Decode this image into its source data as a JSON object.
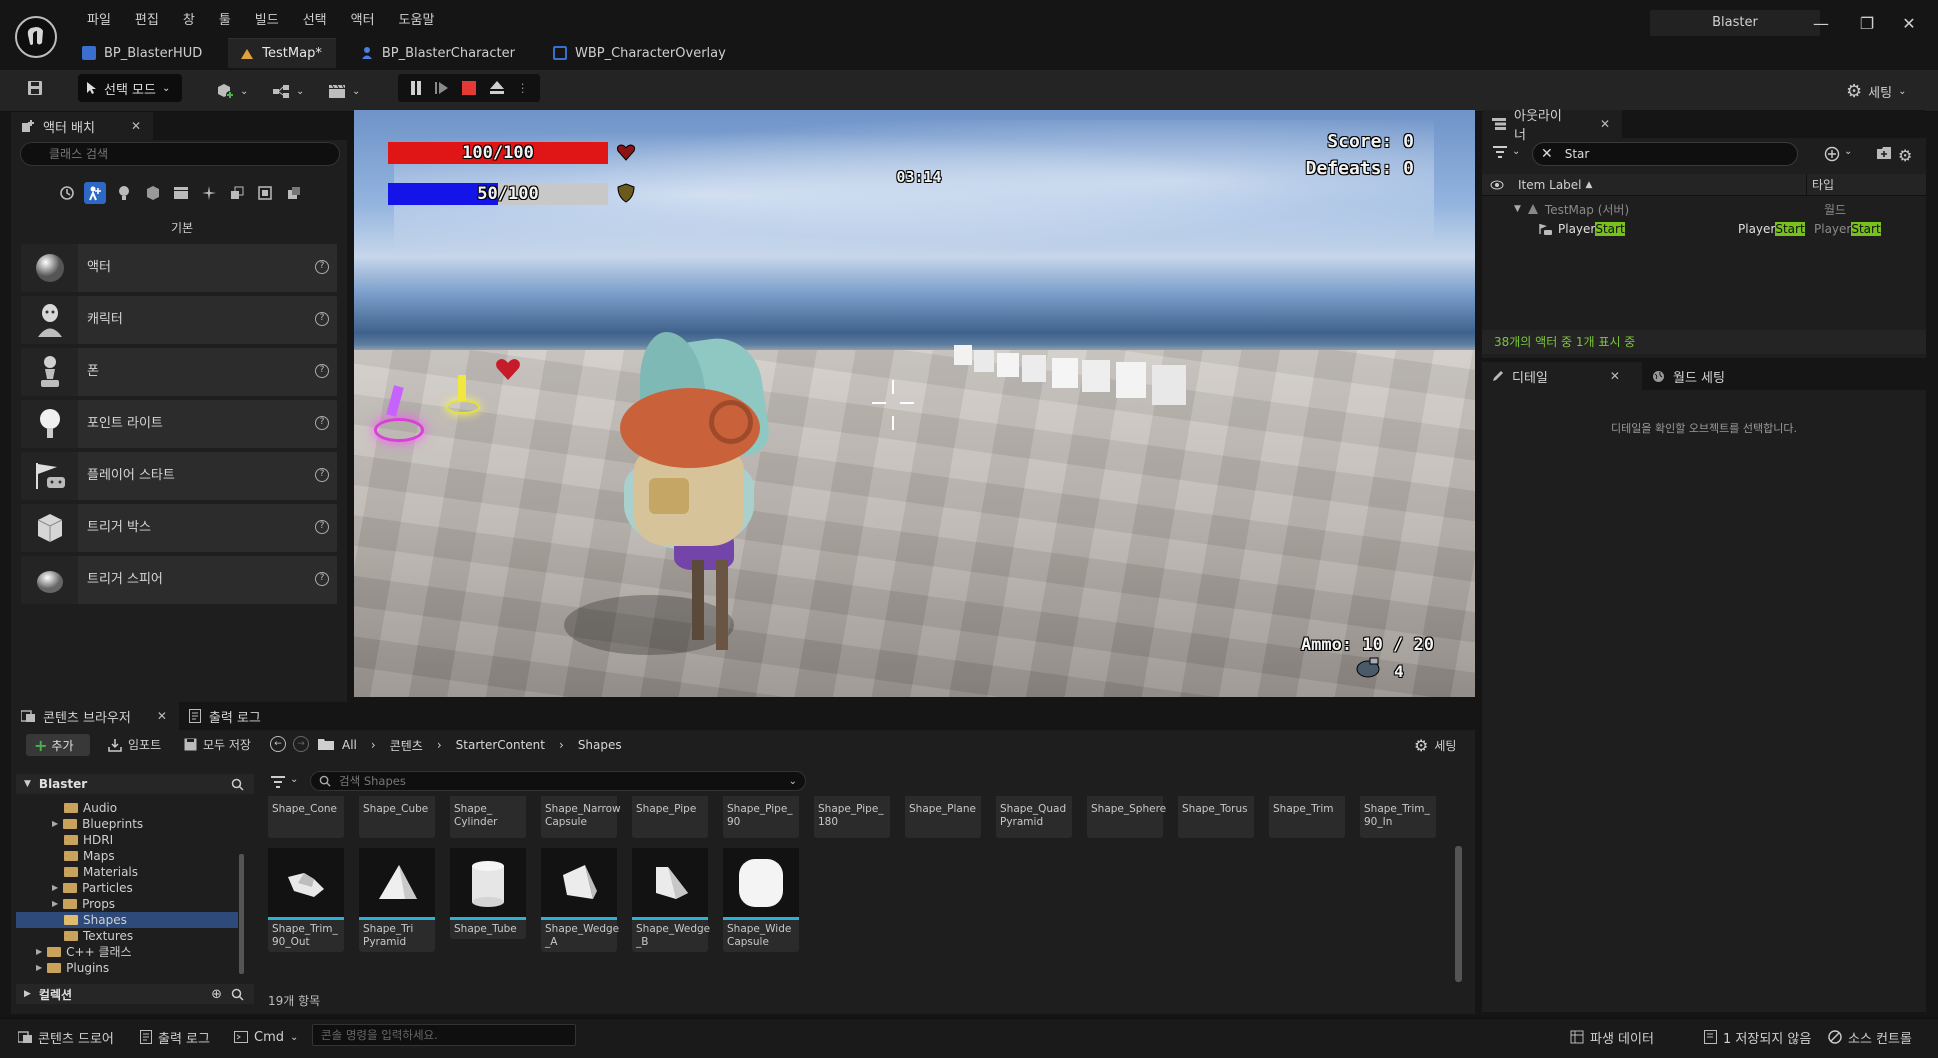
{
  "app": {
    "menu": [
      "파일",
      "편집",
      "창",
      "툴",
      "빌드",
      "선택",
      "액터",
      "도움말"
    ],
    "project_name": "Blaster"
  },
  "doc_tabs": [
    {
      "label": "BP_BlasterHUD",
      "icon": "blueprint-icon"
    },
    {
      "label": "TestMap*",
      "icon": "level-icon",
      "active": true
    },
    {
      "label": "BP_BlasterCharacter",
      "icon": "character-blueprint-icon"
    },
    {
      "label": "WBP_CharacterOverlay",
      "icon": "widget-blueprint-icon"
    }
  ],
  "toolbar": {
    "mode_label": "선택 모드",
    "settings_label": "세팅"
  },
  "place_actors": {
    "tab_label": "액터 배치",
    "search_placeholder": "클래스 검색",
    "category_label": "기본",
    "items": [
      {
        "label": "액터",
        "icon": "actor-sphere-icon"
      },
      {
        "label": "캐릭터",
        "icon": "character-icon"
      },
      {
        "label": "폰",
        "icon": "pawn-icon"
      },
      {
        "label": "포인트 라이트",
        "icon": "point-light-icon"
      },
      {
        "label": "플레이어 스타트",
        "icon": "player-start-icon"
      },
      {
        "label": "트리거 박스",
        "icon": "trigger-box-icon"
      },
      {
        "label": "트리거 스피어",
        "icon": "trigger-sphere-icon"
      }
    ]
  },
  "hud": {
    "health_text": "100/100",
    "health_fraction": 1.0,
    "shield_text": "50/100",
    "shield_fraction": 0.5,
    "timer": "03:14",
    "score_line": "Score: 0",
    "defeats_line": "Defeats: 0",
    "ammo_line": "Ammo: 10 / 20",
    "grenades": "4",
    "colors": {
      "health": "#e01616",
      "shield": "#1414e8"
    }
  },
  "outliner": {
    "tab_label": "아웃라이너",
    "filter_text": "Star",
    "col_label": "Item Label",
    "col_type": "타입",
    "rows": [
      {
        "label": "TestMap (서버)",
        "type": "월드"
      },
      {
        "label_prefix": "Player",
        "label_highlight": "Start",
        "type_prefix": "Player",
        "type_highlight": "Start",
        "type2_prefix": "Player",
        "type2_highlight": "Start"
      }
    ],
    "status": "38개의 액터 중 1개 표시 중"
  },
  "details": {
    "tab_label": "디테일",
    "world_tab_label": "월드 세팅",
    "empty_message": "디테일을 확인할 오브젝트를 선택합니다."
  },
  "content_browser": {
    "tab_label": "콘텐츠 브라우저",
    "output_tab_label": "출력 로그",
    "add_label": "추가",
    "import_label": "임포트",
    "save_all_label": "모두 저장",
    "breadcrumb": [
      "All",
      "콘텐츠",
      "StarterContent",
      "Shapes"
    ],
    "settings_label": "세팅",
    "search_placeholder": "검색 Shapes",
    "root": "Blaster",
    "tree": [
      {
        "label": "Audio",
        "expandable": false
      },
      {
        "label": "Blueprints",
        "expandable": true
      },
      {
        "label": "HDRI",
        "expandable": false
      },
      {
        "label": "Maps",
        "expandable": false
      },
      {
        "label": "Materials",
        "expandable": false
      },
      {
        "label": "Particles",
        "expandable": true
      },
      {
        "label": "Props",
        "expandable": true
      },
      {
        "label": "Shapes",
        "expandable": false,
        "selected": true
      },
      {
        "label": "Textures",
        "expandable": false
      }
    ],
    "cpp_label": "C++ 클래스",
    "plugins_label": "Plugins",
    "collections_label": "컬렉션",
    "top_row": [
      "Shape_Cone",
      "Shape_Cube",
      "Shape_\nCylinder",
      "Shape_Narrow\nCapsule",
      "Shape_Pipe",
      "Shape_Pipe_\n90",
      "Shape_Pipe_\n180",
      "Shape_Plane",
      "Shape_Quad\nPyramid",
      "Shape_Sphere",
      "Shape_Torus",
      "Shape_Trim",
      "Shape_Trim_\n90_In"
    ],
    "assets": [
      {
        "label": "Shape_Trim_\n90_Out",
        "icon": "trim-90-out-icon"
      },
      {
        "label": "Shape_Tri\nPyramid",
        "icon": "tri-pyramid-icon"
      },
      {
        "label": "Shape_Tube",
        "icon": "tube-icon"
      },
      {
        "label": "Shape_Wedge\n_A",
        "icon": "wedge-a-icon"
      },
      {
        "label": "Shape_Wedge\n_B",
        "icon": "wedge-b-icon"
      },
      {
        "label": "Shape_Wide\nCapsule",
        "icon": "wide-capsule-icon"
      }
    ],
    "item_count": "19개 항목"
  },
  "statusbar": {
    "content_drawer": "콘텐츠 드로어",
    "output_log": "출력 로그",
    "cmd": "Cmd",
    "console_placeholder": "콘솔 명령을 입력하세요.",
    "derived_data": "파생 데이터",
    "unsaved": "1 저장되지 않음",
    "source_control": "소스 컨트롤"
  }
}
